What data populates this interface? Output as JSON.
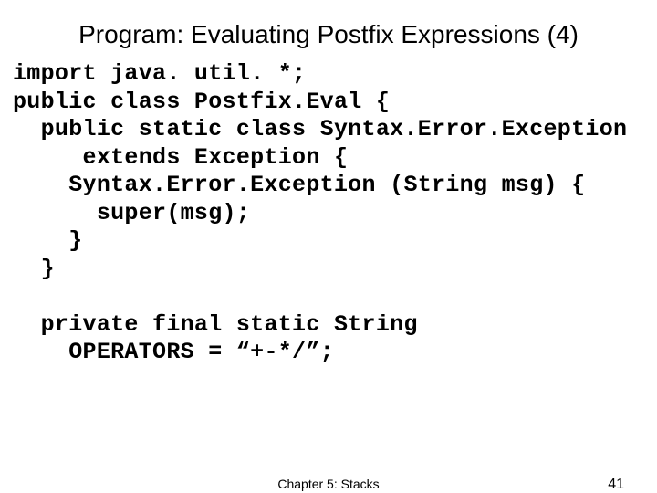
{
  "title": "Program: Evaluating Postfix Expressions (4)",
  "code": "import java. util. *;\npublic class Postfix.Eval {\n  public static class Syntax.Error.Exception\n     extends Exception {\n    Syntax.Error.Exception (String msg) {\n      super(msg);\n    }\n  }\n\n  private final static String\n    OPERATORS = “+-*/”;",
  "footer": {
    "center": "Chapter 5: Stacks",
    "page": "41"
  }
}
